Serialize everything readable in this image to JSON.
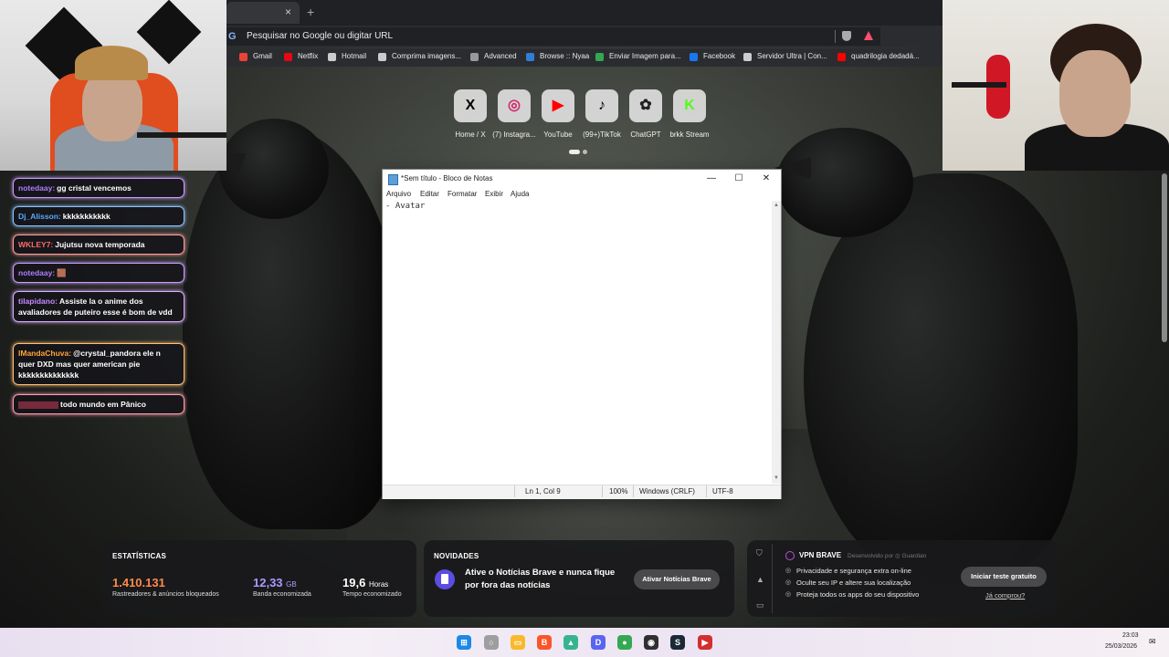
{
  "browser": {
    "tab_close": "×",
    "new_tab": "+",
    "omnibox_placeholder": "Pesquisar no Google ou digitar URL",
    "bookmarks": [
      {
        "label": "Gmail",
        "icon": "gmail-icon",
        "color": "#ea4335"
      },
      {
        "label": "Netflix",
        "icon": "netflix-icon",
        "color": "#e50914"
      },
      {
        "label": "Hotmail",
        "icon": "hotmail-icon",
        "color": "#cccccc"
      },
      {
        "label": "Comprima imagens...",
        "icon": "compress-icon",
        "color": "#cccccc"
      },
      {
        "label": "Advanced",
        "icon": "advanced-icon",
        "color": "#999999"
      },
      {
        "label": "Browse :: Nyaa",
        "icon": "nyaa-icon",
        "color": "#2f7fd8"
      },
      {
        "label": "Enviar Imagem para...",
        "icon": "upload-icon",
        "color": "#33a852"
      },
      {
        "label": "Facebook",
        "icon": "facebook-icon",
        "color": "#1877f2"
      },
      {
        "label": "Servidor Ultra | Con...",
        "icon": "server-icon",
        "color": "#cccccc"
      },
      {
        "label": "quadrilogia dedadá...",
        "icon": "youtube-icon",
        "color": "#ff0000"
      }
    ]
  },
  "shortcuts": [
    {
      "label": "Home / X",
      "glyph": "X",
      "icon": "x-icon",
      "color": "#000000"
    },
    {
      "label": "(7) Instagra...",
      "glyph": "◎",
      "icon": "instagram-icon",
      "color": "#d6246e"
    },
    {
      "label": "YouTube",
      "glyph": "▶",
      "icon": "youtube-icon",
      "color": "#ff0000"
    },
    {
      "label": "(99+)TikTok",
      "glyph": "♪",
      "icon": "tiktok-icon",
      "color": "#000000"
    },
    {
      "label": "ChatGPT",
      "glyph": "✿",
      "icon": "chatgpt-icon",
      "color": "#222222"
    },
    {
      "label": "brkk Stream",
      "glyph": "K",
      "icon": "kick-icon",
      "color": "#53fc18"
    }
  ],
  "chat": [
    {
      "user": "notedaay:",
      "text": "gg cristal vencemos",
      "user_color": "#b07cff",
      "border": "#c99cff"
    },
    {
      "user": "Dj_Alisson:",
      "text": "kkkkkkkkkkk",
      "user_color": "#5aa8ff",
      "border": "#8cc3ff"
    },
    {
      "user": "WKLEY7:",
      "text": "Jujutsu nova temporada",
      "user_color": "#ff6a6a",
      "border": "#ff9c9c"
    },
    {
      "user": "notedaay:",
      "text": "🟫",
      "user_color": "#b07cff",
      "border": "#c99cff"
    },
    {
      "user": "tilapidano:",
      "text": "Assiste la o anime dos avaliadores de puteiro esse é bom de vdd",
      "user_color": "#c78bff",
      "border": "#d9adff"
    },
    {
      "user": "lMandaChuva:",
      "text": "@crystal_pandora ele n quer DXD mas quer american pie kkkkkkkkkkkkkk",
      "user_color": "#ffa53a",
      "border": "#ffbf73"
    },
    {
      "user": "",
      "text": "todo mundo em Pânico",
      "user_color": "#ff6a8a",
      "border": "#ff9cb1"
    }
  ],
  "notepad": {
    "title": "*Sem título - Bloco de Notas",
    "menu": [
      "Arquivo",
      "Editar",
      "Formatar",
      "Exibir",
      "Ajuda"
    ],
    "content": "- Avatar",
    "minimize": "—",
    "maximize": "☐",
    "close": "✕",
    "status": {
      "position": "Ln 1, Col 9",
      "zoom": "100%",
      "line_ending": "Windows (CRLF)",
      "encoding": "UTF-8"
    }
  },
  "stats": {
    "heading": "ESTATÍSTICAS",
    "blocked": {
      "value": "1.410.131",
      "label": "Rastreadores & anúncios bloqueados",
      "color": "#ff8a4a"
    },
    "bandwidth": {
      "value": "12,33",
      "unit": "GB",
      "label": "Banda economizada",
      "color": "#a89cff"
    },
    "time": {
      "value": "19,6",
      "unit": "Horas",
      "label": "Tempo economizado",
      "color": "#ffffff"
    }
  },
  "news": {
    "heading": "NOVIDADES",
    "text": "Ative o Notícias Brave e nunca fique por fora das notícias",
    "button": "Ativar Notícias Brave"
  },
  "vpn": {
    "title": "VPN BRAVE",
    "by": "Desenvolvido por ◎ Guardian",
    "features": [
      "Privacidade e segurança extra on-line",
      "Oculte seu IP e altere sua localização",
      "Proteja todos os apps do seu dispositivo"
    ],
    "button": "Iniciar teste gratuito",
    "link": "Já comprou?"
  },
  "taskbar": {
    "time": "23:03",
    "date": "25/03/2026",
    "apps": [
      {
        "name": "windows-start",
        "glyph": "⊞",
        "color": "#1e88e5"
      },
      {
        "name": "search",
        "glyph": "○",
        "color": "#9e9e9e"
      },
      {
        "name": "file-explorer",
        "glyph": "▭",
        "color": "#f9b92b"
      },
      {
        "name": "brave",
        "glyph": "B",
        "color": "#fb542b"
      },
      {
        "name": "app-green",
        "glyph": "▲",
        "color": "#36b38f"
      },
      {
        "name": "discord",
        "glyph": "D",
        "color": "#5865f2"
      },
      {
        "name": "chrome",
        "glyph": "●",
        "color": "#34a853"
      },
      {
        "name": "obs",
        "glyph": "◉",
        "color": "#302e31"
      },
      {
        "name": "steam",
        "glyph": "S",
        "color": "#1b2838"
      },
      {
        "name": "recorder",
        "glyph": "▶",
        "color": "#d32f2f"
      }
    ]
  }
}
